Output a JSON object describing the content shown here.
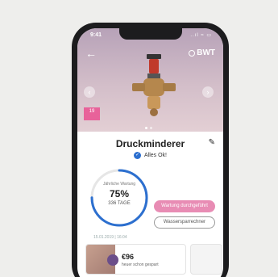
{
  "status_bar": {
    "time": "9:41",
    "icons": "..ıl ≈ ▭"
  },
  "header": {
    "back": "←",
    "brand": "BWT"
  },
  "carousel": {
    "prev": "‹",
    "next": "›",
    "badge": "19"
  },
  "product": {
    "title": "Druckminderer",
    "status": "Alles Ok!",
    "edit": "✎",
    "check": "✓"
  },
  "maintenance": {
    "caption": "Jährliche Wartung",
    "percent": "75%",
    "progress": 0.75,
    "days": "336 TAGE",
    "date": "15.01.2019 | 16:04",
    "primary_button": "Wartung durchgeführt",
    "secondary_button": "Wassersparrechner"
  },
  "savings_card": {
    "amount": "€96",
    "subtitle": "heuer schon gespart"
  },
  "colors": {
    "accent_pink": "#e88cb4",
    "brand_blue": "#2c6fcf"
  }
}
